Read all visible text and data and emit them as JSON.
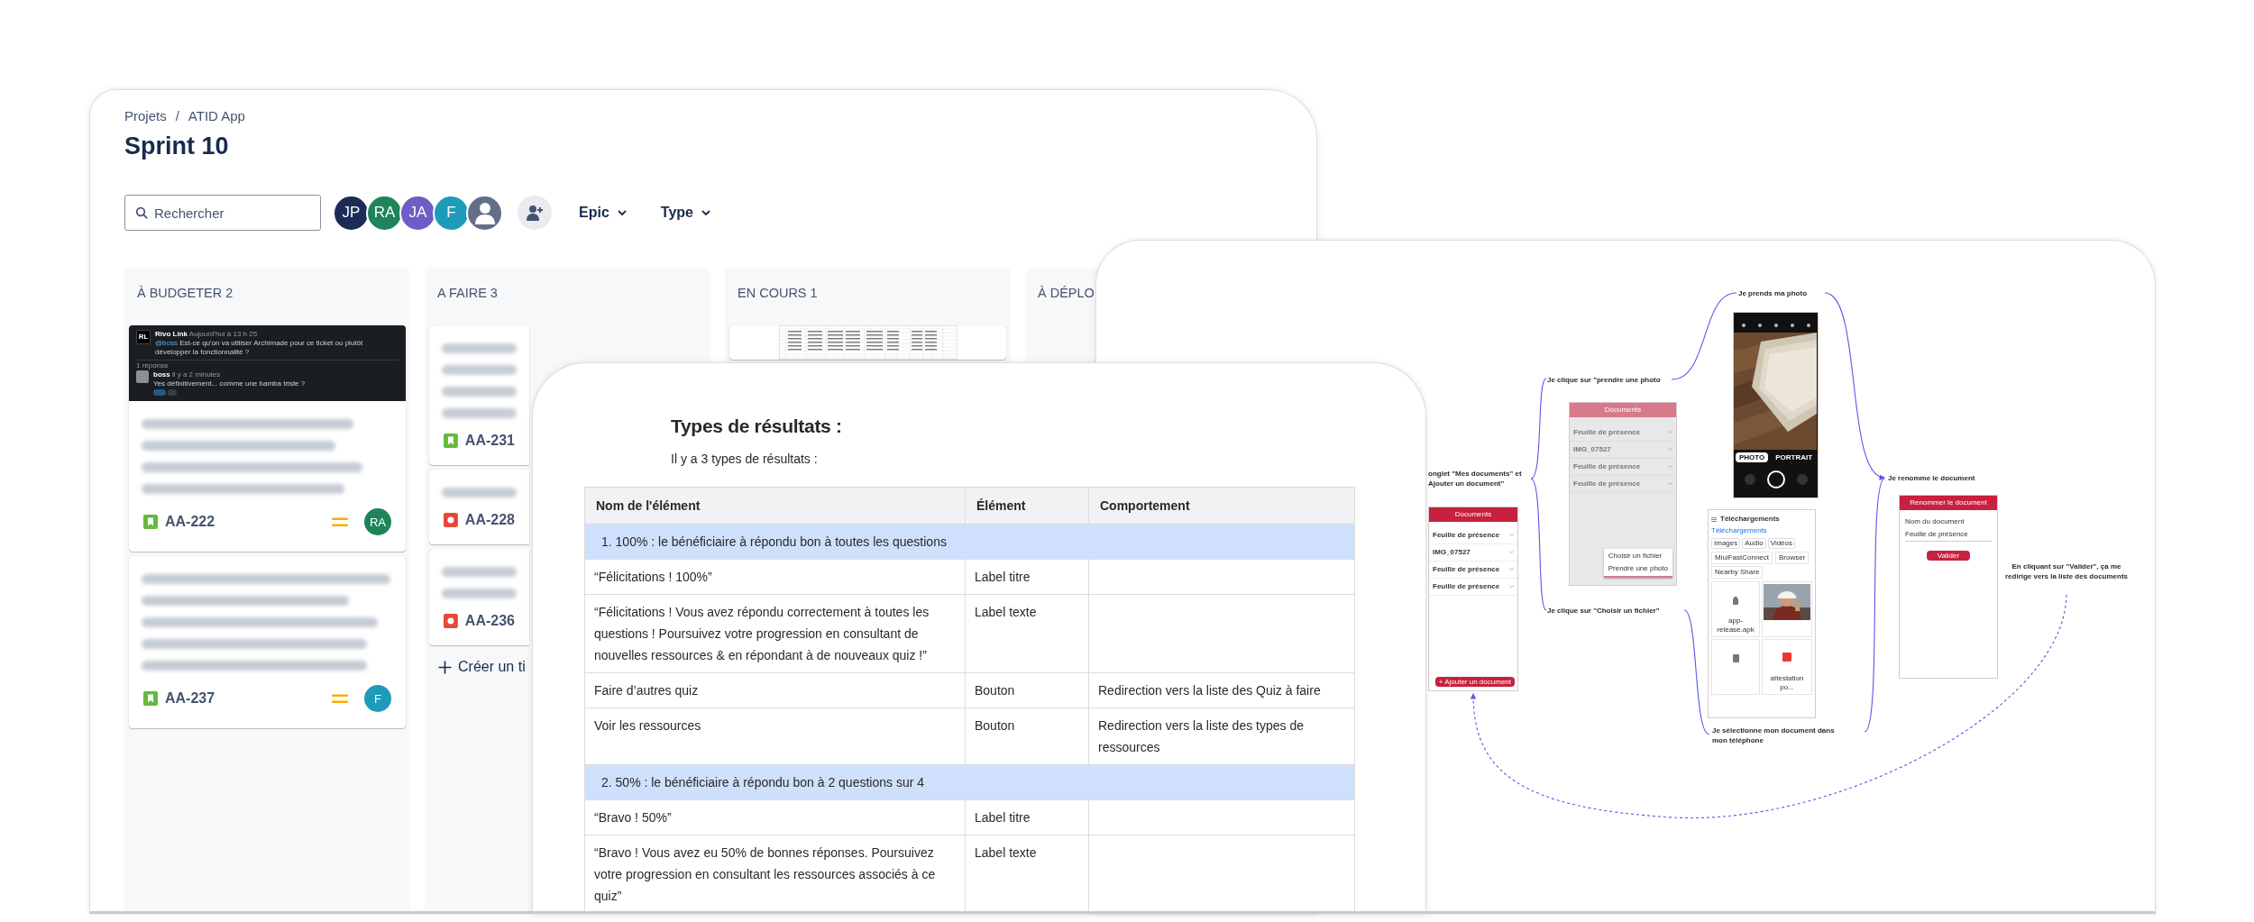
{
  "board": {
    "breadcrumb": [
      "Projets",
      "/",
      "ATID App"
    ],
    "title": "Sprint 10",
    "search": {
      "placeholder": "Rechercher"
    },
    "avatars": [
      {
        "kind": "initials",
        "initials": "JP",
        "color": "#1d2b57"
      },
      {
        "kind": "initials",
        "initials": "RA",
        "color": "#1f845a"
      },
      {
        "kind": "initials",
        "initials": "JA",
        "color": "#6e5dc6"
      },
      {
        "kind": "initials",
        "initials": "F",
        "color": "#1d9bb9"
      },
      {
        "kind": "silhouette",
        "color": "#626f86"
      }
    ],
    "filters": [
      "Epic",
      "Type"
    ],
    "columns": [
      {
        "title": "À BUDGETER 2",
        "cards": [
          {
            "attachment": {
              "kind": "chat",
              "initials": "RL",
              "author": "Rivo Link",
              "time": "Aujourd'hui à 13 h 25",
              "mention": "@boss",
              "message": "Est-ce qu'on va utiliser Archimade pour ce ticket ou plutôt développer la fonctionnalité ?",
              "replies": "1 réponse",
              "reply_author": "boss",
              "reply_time": "il y a 2 minutes",
              "reply": "Yes définitivement... comme une bamba triste ?"
            },
            "key": "AA-222",
            "type_icon": {
              "kind": "story"
            },
            "priority_icon": {
              "kind": "medium"
            },
            "assignee": {
              "initials": "RA",
              "color": "#1f845a"
            }
          },
          {
            "key": "AA-237",
            "type_icon": {
              "kind": "story"
            },
            "priority_icon": {
              "kind": "medium"
            },
            "assignee": {
              "initials": "F",
              "color": "#1d9bb9"
            }
          }
        ]
      },
      {
        "title": "A FAIRE 3",
        "cards": [
          {
            "key": "AA-231",
            "type_icon": {
              "kind": "story"
            }
          },
          {
            "key": "AA-228",
            "type_icon": {
              "kind": "bug"
            }
          },
          {
            "key": "AA-236",
            "type_icon": {
              "kind": "bug"
            }
          }
        ],
        "create_label": "Créer un ti"
      },
      {
        "title": "EN COURS 1",
        "cards": [
          {
            "attachment": {
              "kind": "spreadsheet"
            }
          }
        ]
      },
      {
        "title": "À DÉPLO"
      }
    ]
  },
  "diagram": {
    "steps": [
      {
        "text": "Je prends ma photo"
      },
      {
        "text": "Je clique sur \"prendre une photo"
      },
      {
        "text": "onglet \"Mes documents\" et\nAjouter un document\""
      },
      {
        "text": "Je renomme le document"
      },
      {
        "text": "Je clique sur \"Choisir un fichier\""
      },
      {
        "text": "Je sélectionne mon document dans\nmon téléphone"
      },
      {
        "text": "En cliquant sur \"Valider\", ça me redirige vers la liste des documents"
      }
    ],
    "phones": [
      {
        "kind": "docs_list",
        "title": "Documents",
        "items": [
          "Feuille de présence",
          "IMG_07527",
          "Feuille de présence",
          "Feuille de présence"
        ],
        "button": "+ Ajouter un document"
      },
      {
        "kind": "docs_menu",
        "title": "Documents",
        "items": [
          "Feuille de présence",
          "IMG_07527",
          "Feuille de présence",
          "Feuille de présence"
        ],
        "menu": [
          "Choisir un fichier",
          "Prendre une photo"
        ]
      },
      {
        "kind": "camera",
        "modes": [
          {
            "label": "PHOTO",
            "selected": true
          },
          {
            "label": "PORTRAIT",
            "selected": false
          }
        ]
      },
      {
        "kind": "downloads",
        "title": "Téléchargements",
        "section": "Téléchargements",
        "chips": [
          "Images",
          "Audio",
          "Vidéos"
        ],
        "folders": [
          "MiuiFastConnect",
          "Browser",
          "Nearby Share"
        ],
        "files": [
          "app-release.apk",
          "attestation po..."
        ]
      },
      {
        "kind": "rename",
        "title": "Renommer le document",
        "field_label": "Nom du document",
        "value": "Feuille de présence",
        "button": "Valider"
      }
    ]
  },
  "document": {
    "heading": "Types de résultats :",
    "intro": "Il y a 3 types de résultats :",
    "table": {
      "columns": [
        "Nom de l'élément",
        "Élément",
        "Comportement"
      ],
      "rows": [
        {
          "kind": "section",
          "text": "1. 100% : le bénéficiaire à répondu bon à toutes les questions"
        },
        {
          "kind": "item",
          "name": "“Félicitations ! 100%”",
          "element": "Label titre"
        },
        {
          "kind": "item",
          "name": "“Félicitations ! Vous avez répondu correctement à toutes les questions ! Poursuivez votre progression en consultant de nouvelles ressources & en répondant à de nouveaux quiz !”",
          "element": "Label texte"
        },
        {
          "kind": "item",
          "name": "Faire d’autres quiz",
          "element": "Bouton",
          "behaviour": "Redirection vers la liste des Quiz à faire"
        },
        {
          "kind": "item",
          "name": "Voir les ressources",
          "element": "Bouton",
          "behaviour": "Redirection vers la liste des types de ressources"
        },
        {
          "kind": "section",
          "text": "2. 50% : le bénéficiaire à répondu bon à 2 questions sur 4"
        },
        {
          "kind": "item",
          "name": "“Bravo ! 50%”",
          "element": "Label titre"
        },
        {
          "kind": "item",
          "name": "“Bravo ! Vous avez eu 50% de bonnes réponses. Poursuivez votre progression en consultant les ressources associés à ce quiz”",
          "element": "Label texte"
        }
      ]
    }
  }
}
